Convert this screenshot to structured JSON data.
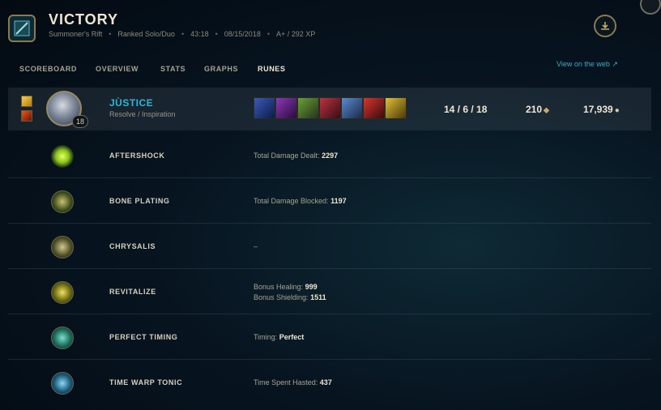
{
  "header": {
    "title": "VICTORY",
    "map": "Summoner's Rift",
    "queue": "Ranked Solo/Duo",
    "duration": "43:18",
    "date": "08/15/2018",
    "grade_xp": "A+ / 292 XP"
  },
  "nav": {
    "tabs": [
      "SCOREBOARD",
      "OVERVIEW",
      "STATS",
      "GRAPHS",
      "RUNES"
    ],
    "active": "RUNES",
    "web_link": "View on the web ↗"
  },
  "player": {
    "name": "JÙSTICE",
    "runes_path": "Resolve / Inspiration",
    "level": "18",
    "kda": "14 / 6 / 18",
    "cs": "210",
    "gold": "17,939"
  },
  "runes": [
    {
      "name": "AFTERSHOCK",
      "stats": [
        {
          "label": "Total Damage Dealt:",
          "value": "2297"
        }
      ]
    },
    {
      "name": "BONE PLATING",
      "stats": [
        {
          "label": "Total Damage Blocked:",
          "value": "1197"
        }
      ]
    },
    {
      "name": "CHRYSALIS",
      "stats": [
        {
          "label": "–",
          "value": ""
        }
      ]
    },
    {
      "name": "REVITALIZE",
      "stats": [
        {
          "label": "Bonus Healing:",
          "value": "999"
        },
        {
          "label": "Bonus Shielding:",
          "value": "1511"
        }
      ]
    },
    {
      "name": "PERFECT TIMING",
      "stats": [
        {
          "label": "Timing:",
          "value": "Perfect"
        }
      ]
    },
    {
      "name": "TIME WARP TONIC",
      "stats": [
        {
          "label": "Time Spent Hasted:",
          "value": "437"
        }
      ]
    }
  ],
  "colors": {
    "accent_blue": "#2fb6d8",
    "gold_border": "#8a7a52",
    "text_light": "#f0e6d2"
  },
  "icons": {
    "mode": "rift-map-icon",
    "download": "download-icon",
    "cs": "minion-icon",
    "gold": "gold-icon"
  }
}
